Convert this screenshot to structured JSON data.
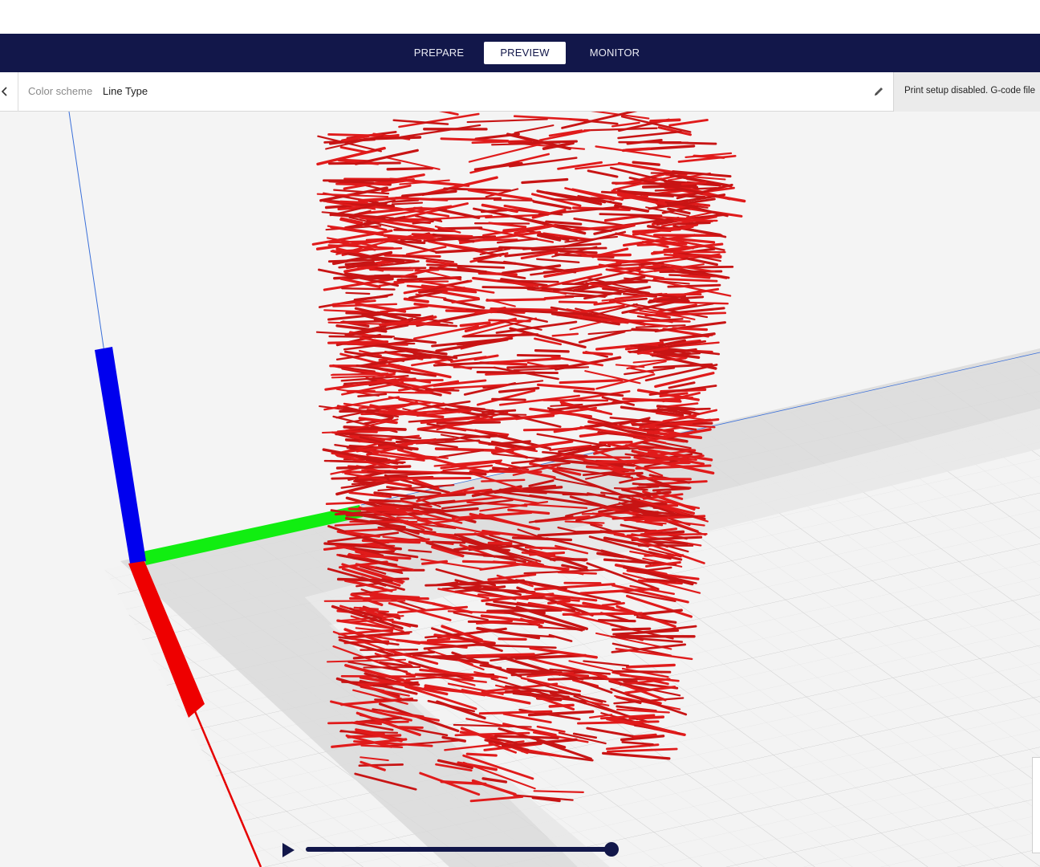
{
  "stages": [
    {
      "label": "PREPARE",
      "active": false
    },
    {
      "label": "PREVIEW",
      "active": true
    },
    {
      "label": "MONITOR",
      "active": false
    }
  ],
  "view_header": {
    "color_scheme_label": "Color scheme",
    "color_scheme_value": "Line Type",
    "notice": "Print setup disabled. G-code file"
  },
  "icons": {
    "collapse": "chevron-left-icon",
    "edit": "pencil-icon",
    "play": "play-icon"
  },
  "simulation": {
    "progress": 1.0
  },
  "colors": {
    "stage_bar": "#12174a",
    "toolpath": "#e01b1b",
    "axis_x": "#ff0000",
    "axis_y": "#00ff00",
    "axis_z": "#0000ff"
  }
}
